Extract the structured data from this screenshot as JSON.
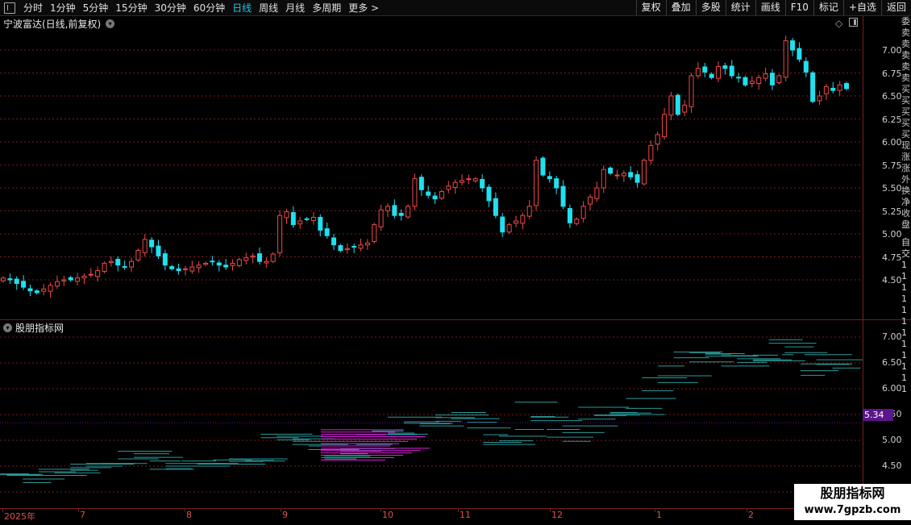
{
  "toolbar": {
    "periods": [
      "分时",
      "1分钟",
      "5分钟",
      "15分钟",
      "30分钟",
      "60分钟",
      "日线",
      "周线",
      "月线",
      "多周期",
      "更多 >"
    ],
    "active_period": "日线",
    "buttons": [
      "复权",
      "叠加",
      "多股",
      "统计",
      "画线",
      "F10",
      "标记",
      "+自选",
      "返回"
    ]
  },
  "main_panel": {
    "title": "宁波富达(日线,前复权)",
    "y_ticks": [
      "7.00",
      "6.75",
      "6.50",
      "6.25",
      "6.00",
      "5.75",
      "5.50",
      "5.25",
      "5.00",
      "4.75",
      "4.50"
    ]
  },
  "indicator_panel": {
    "title": "股朋指标网",
    "y_ticks": [
      "7.00",
      "6.50",
      "6.00",
      "5.50",
      "5.00",
      "4.50"
    ],
    "current_price": "5.34"
  },
  "date_axis": [
    "2025年",
    "7",
    "8",
    "9",
    "10",
    "11",
    "12",
    "1",
    "2"
  ],
  "right_strip_text": "委卖卖卖卖卖买买买买买现涨涨外换净收盘",
  "right_strip_text2": "自交111111111111",
  "watermark": {
    "title": "股朋指标网",
    "url": "www.7gpzb.com"
  },
  "colors": {
    "up": "#f04848",
    "down": "#20e0f0",
    "grid": "#7a1c1c",
    "highlight": "#e020e0",
    "accent": "#20c4e8"
  },
  "chart_data": {
    "type": "candlestick",
    "title": "宁波富达(日线,前复权)",
    "ylim": [
      4.3,
      7.2
    ],
    "x_ticks": [
      "2025年",
      "7",
      "8",
      "9",
      "10",
      "11",
      "12",
      "1",
      "2"
    ],
    "closes": [
      4.52,
      4.5,
      4.46,
      4.42,
      4.38,
      4.36,
      4.4,
      4.44,
      4.48,
      4.5,
      4.5,
      4.52,
      4.54,
      4.56,
      4.6,
      4.68,
      4.7,
      4.66,
      4.64,
      4.7,
      4.82,
      4.94,
      4.86,
      4.76,
      4.66,
      4.62,
      4.6,
      4.62,
      4.64,
      4.66,
      4.68,
      4.7,
      4.66,
      4.64,
      4.68,
      4.72,
      4.74,
      4.76,
      4.7,
      4.7,
      4.78,
      5.2,
      5.24,
      5.1,
      5.14,
      5.16,
      5.18,
      5.04,
      4.98,
      4.88,
      4.82,
      4.84,
      4.86,
      4.88,
      4.9,
      5.1,
      5.26,
      5.3,
      5.2,
      5.2,
      5.3,
      5.6,
      5.48,
      5.42,
      5.38,
      5.46,
      5.52,
      5.56,
      5.58,
      5.6,
      5.6,
      5.5,
      5.36,
      5.2,
      5.02,
      5.1,
      5.14,
      5.2,
      5.3,
      5.8,
      5.64,
      5.6,
      5.5,
      5.3,
      5.12,
      5.16,
      5.3,
      5.4,
      5.5,
      5.7,
      5.66,
      5.64,
      5.66,
      5.62,
      5.56,
      5.8,
      5.96,
      6.08,
      6.3,
      6.5,
      6.3,
      6.4,
      6.72,
      6.8,
      6.76,
      6.7,
      6.82,
      6.8,
      6.72,
      6.7,
      6.62,
      6.66,
      6.7,
      6.74,
      6.62,
      6.72,
      7.1,
      7.0,
      6.9,
      6.76,
      6.44,
      6.5,
      6.6,
      6.56,
      6.62,
      6.58
    ]
  }
}
